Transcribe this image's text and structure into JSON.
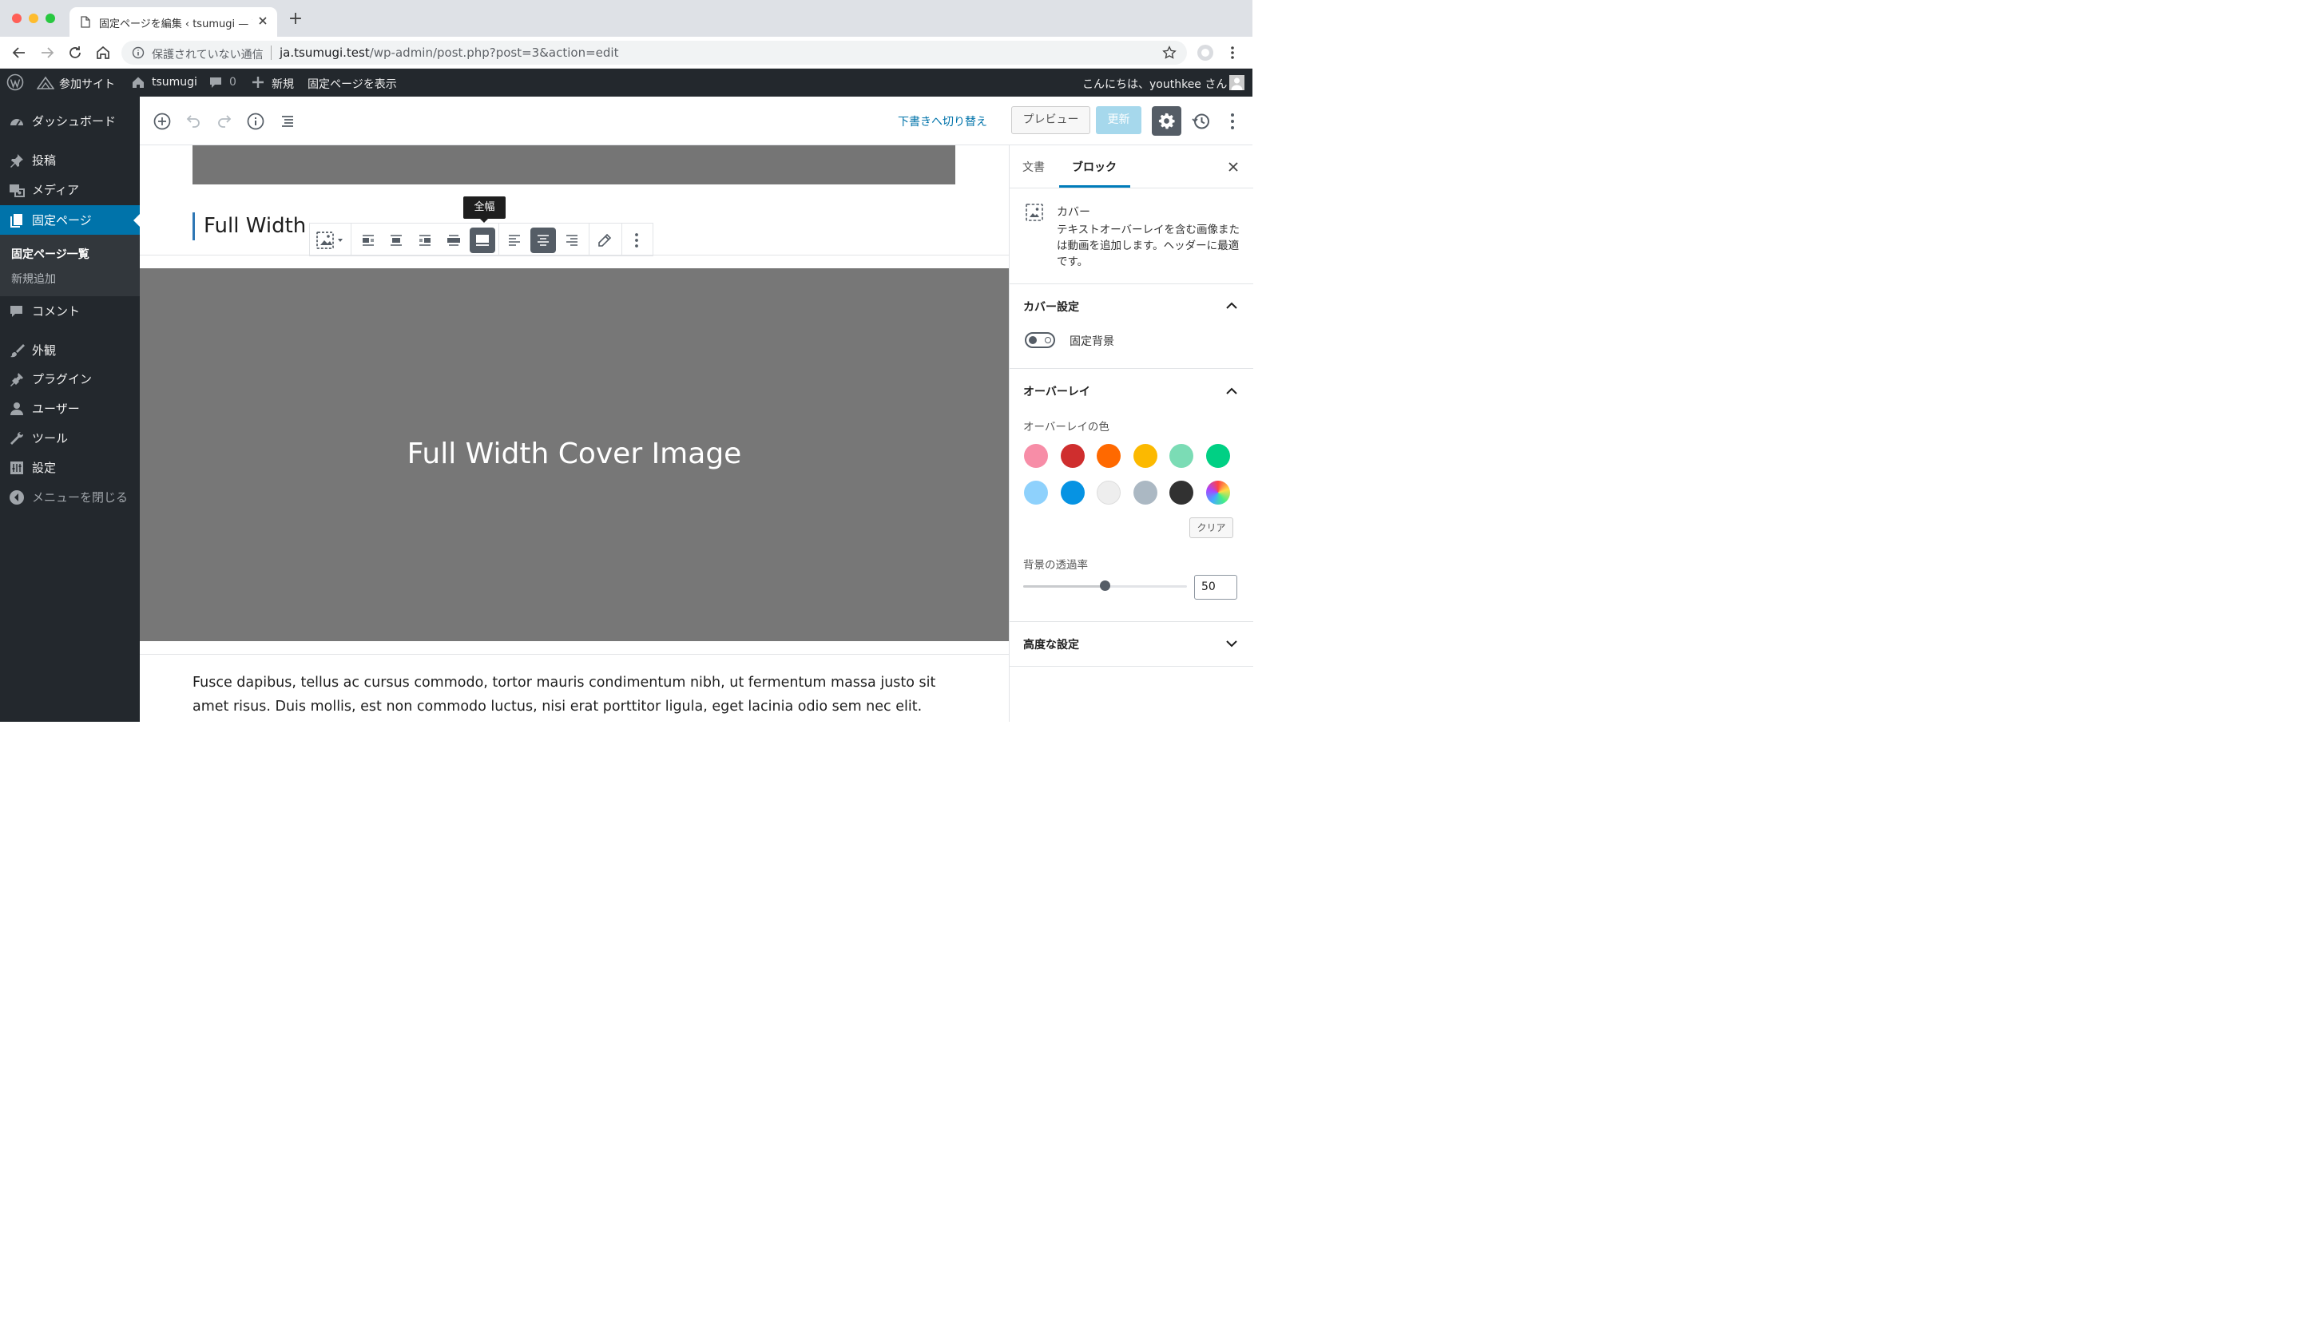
{
  "browser": {
    "tab_title": "固定ページを編集 ‹ tsumugi — W",
    "new_tab": "+",
    "security_label": "保護されていない通信",
    "url_host": "ja.tsumugi.test",
    "url_path": "/wp-admin/post.php?post=3&action=edit"
  },
  "adminbar": {
    "my_sites": "参加サイト",
    "site_name": "tsumugi",
    "comments_count": "0",
    "new": "新規",
    "view_page": "固定ページを表示",
    "greeting": "こんにちは、youthkee さん"
  },
  "menu": {
    "dashboard": "ダッシュボード",
    "posts": "投稿",
    "media": "メディア",
    "pages": "固定ページ",
    "pages_all": "固定ページ一覧",
    "pages_new": "新規追加",
    "comments": "コメント",
    "appearance": "外観",
    "plugins": "プラグイン",
    "users": "ユーザー",
    "tools": "ツール",
    "settings": "設定",
    "collapse": "メニューを閉じる"
  },
  "editor": {
    "switch_to_draft": "下書きへ切り替え",
    "preview": "プレビュー",
    "update": "更新",
    "heading": "Full Width",
    "tooltip": "全幅",
    "cover_text": "Full Width Cover Image",
    "paragraph": "Fusce dapibus, tellus ac cursus commodo, tortor mauris condimentum nibh, ut fermentum massa justo sit amet risus. Duis mollis, est non commodo luctus, nisi erat porttitor ligula, eget lacinia odio sem nec elit."
  },
  "sidebar": {
    "tab_document": "文書",
    "tab_block": "ブロック",
    "block_name": "カバー",
    "block_description": "テキストオーバーレイを含む画像または動画を追加します。ヘッダーに最適です。",
    "cover_settings": "カバー設定",
    "fixed_background": "固定背景",
    "overlay": "オーバーレイ",
    "overlay_color": "オーバーレイの色",
    "clear": "クリア",
    "background_opacity": "背景の透過率",
    "opacity_value": "50",
    "advanced": "高度な設定",
    "swatches": [
      "#f78da7",
      "#cf2e2e",
      "#ff6900",
      "#fcb900",
      "#7bdcb5",
      "#00d084",
      "#8ed1fc",
      "#0693e3",
      "#eeeeee",
      "#abb8c3",
      "#313131",
      "gradient"
    ]
  },
  "colors": {
    "admin_bg": "#23282d",
    "accent": "#0073aa",
    "cover_gray": "#777777"
  }
}
